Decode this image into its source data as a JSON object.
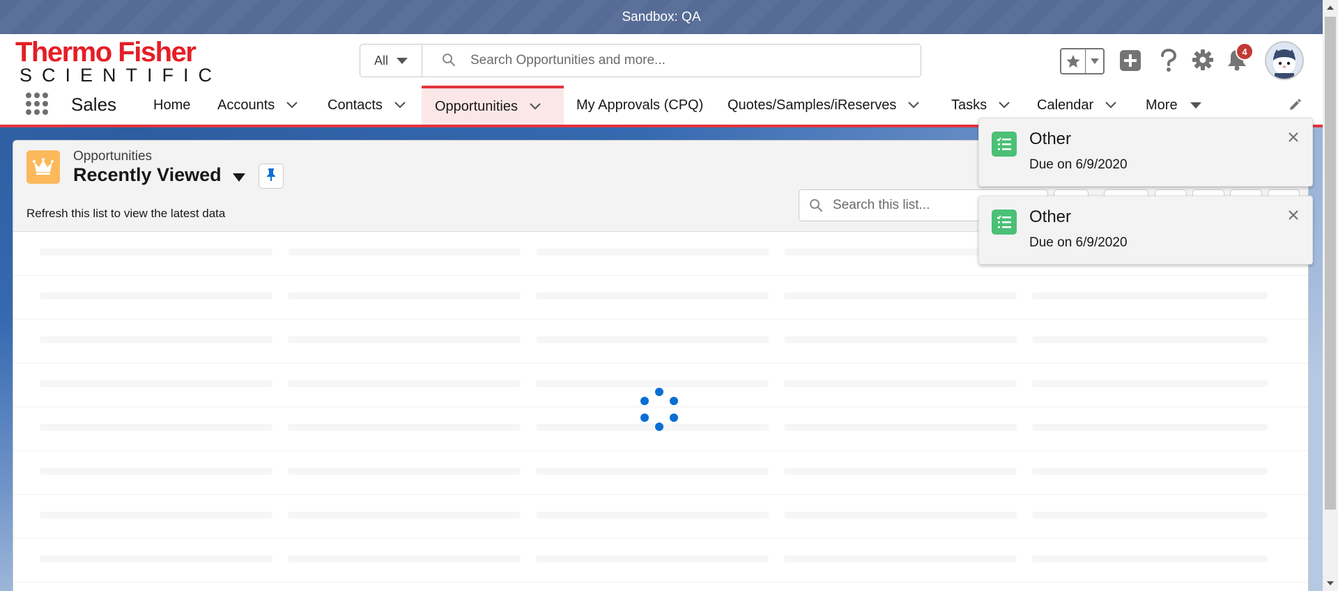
{
  "sandbox_bar": {
    "label": "Sandbox: QA"
  },
  "logo": {
    "line1": "Thermo Fisher",
    "line2": "SCIENTIFIC"
  },
  "global_search": {
    "scope": "All",
    "placeholder": "Search Opportunities and more..."
  },
  "header_icons": {
    "favorites": "star-icon",
    "add": "plus-icon",
    "help": "help-icon",
    "setup": "gear-icon",
    "notifications": "bell-icon",
    "notification_count": "4"
  },
  "nav": {
    "app_name": "Sales",
    "items": [
      {
        "label": "Home",
        "has_dropdown": false
      },
      {
        "label": "Accounts",
        "has_dropdown": true
      },
      {
        "label": "Contacts",
        "has_dropdown": true
      },
      {
        "label": "Opportunities",
        "has_dropdown": true,
        "active": true
      },
      {
        "label": "My Approvals (CPQ)",
        "has_dropdown": false
      },
      {
        "label": "Quotes/Samples/iReserves",
        "has_dropdown": true
      },
      {
        "label": "Tasks",
        "has_dropdown": true
      },
      {
        "label": "Calendar",
        "has_dropdown": true
      },
      {
        "label": "More",
        "has_dropdown": true
      }
    ]
  },
  "list_view": {
    "object_label": "Opportunities",
    "view_name": "Recently Viewed",
    "refresh_message": "Refresh this list to view the latest data",
    "search_placeholder": "Search this list...",
    "loading": true
  },
  "toasts": [
    {
      "title": "Other",
      "subtitle": "Due on 6/9/2020"
    },
    {
      "title": "Other",
      "subtitle": "Due on 6/9/2020"
    }
  ],
  "colors": {
    "brand_red": "#e41e26",
    "nav_active_bar": "#e3343f",
    "spinner_blue": "#0b6ed3",
    "toast_icon_green": "#4bc076",
    "object_icon_orange": "#fcb95b",
    "badge_red": "#c23934"
  }
}
